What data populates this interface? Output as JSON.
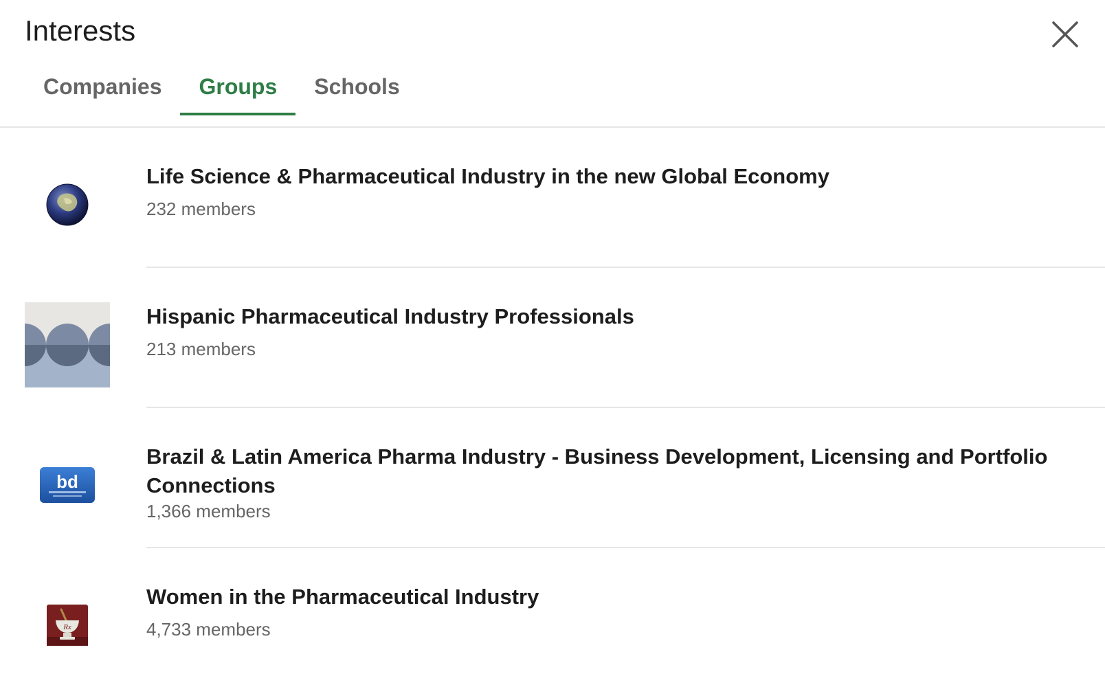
{
  "header": {
    "title": "Interests",
    "close_icon": "close-icon"
  },
  "tabs": [
    {
      "label": "Companies",
      "active": false
    },
    {
      "label": "Groups",
      "active": true
    },
    {
      "label": "Schools",
      "active": false
    }
  ],
  "colors": {
    "accent": "#2e7d46",
    "text_primary": "#1d1d1d",
    "text_secondary": "#666666",
    "divider": "#e6e6e6"
  },
  "groups": [
    {
      "name": "Life Science & Pharmaceutical Industry in the new Global Economy",
      "members": "232 members",
      "logo_icon": "globe-logo"
    },
    {
      "name": "Hispanic Pharmaceutical Industry Professionals",
      "members": "213 members",
      "logo_icon": "circles-pattern-logo"
    },
    {
      "name": "Brazil & Latin America Pharma Industry - Business Development, Licensing and Portfolio Connections",
      "members": "1,366 members",
      "logo_icon": "bd-logo",
      "logo_text": "bd"
    },
    {
      "name": "Women in the Pharmaceutical Industry",
      "members": "4,733 members",
      "logo_icon": "mortar-pestle-logo"
    }
  ]
}
